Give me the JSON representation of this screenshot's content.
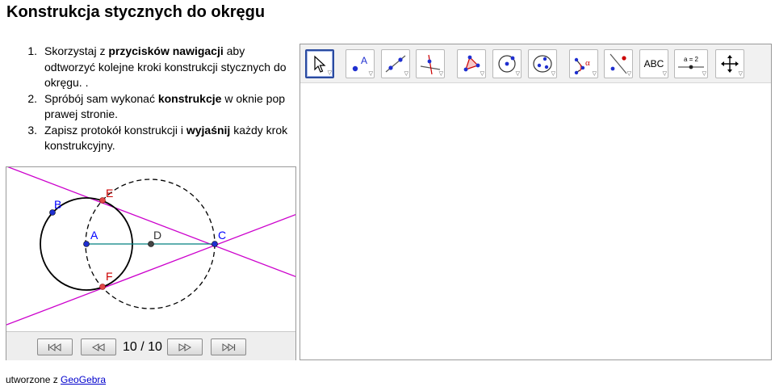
{
  "page": {
    "title": "Konstrukcja stycznych do okręgu",
    "instructions": [
      {
        "num": "1.",
        "before": "Skorzystaj z ",
        "bold": "przycisków nawigacji",
        "after": " aby odtworzyć kolejne kroki konstrukcji stycznych do okręgu. ."
      },
      {
        "num": "2.",
        "before": "Spróbój sam wykonać ",
        "bold": "konstrukcje",
        "after": " w oknie pop prawej stronie."
      },
      {
        "num": "3.",
        "before": "Zapisz protokół konstrukcji i ",
        "bold": "wyjaśnij",
        "after": " każdy krok konstrukcyjny."
      }
    ],
    "footer": {
      "prefix": "utworzone z ",
      "link": "GeoGebra"
    }
  },
  "construction_view": {
    "points": [
      {
        "label": "A",
        "color": "#0000ff"
      },
      {
        "label": "B",
        "color": "#0000ff"
      },
      {
        "label": "C",
        "color": "#0000ff"
      },
      {
        "label": "D",
        "color": "#333333"
      },
      {
        "label": "E",
        "color": "#cc0000"
      },
      {
        "label": "F",
        "color": "#cc0000"
      }
    ],
    "tangent_color": "#cc00cc",
    "segment_color": "#008080",
    "step_counter": "10 / 10"
  },
  "navigation": {
    "buttons": [
      {
        "name": "first-step-icon",
        "glyph": "|◁◁"
      },
      {
        "name": "previous-step-icon",
        "glyph": "◁◁"
      },
      {
        "name": "next-step-icon",
        "glyph": "▷▷"
      },
      {
        "name": "last-step-icon",
        "glyph": "▷▷|"
      }
    ]
  },
  "toolbar": {
    "tools": [
      {
        "name": "move-tool-icon",
        "label": ""
      },
      {
        "name": "point-tool-icon",
        "label": "A"
      },
      {
        "name": "line-tool-icon",
        "label": ""
      },
      {
        "name": "perpendicular-tool-icon",
        "label": ""
      },
      {
        "name": "polygon-tool-icon",
        "label": ""
      },
      {
        "name": "circle-tool-icon",
        "label": ""
      },
      {
        "name": "conic-tool-icon",
        "label": ""
      },
      {
        "name": "angle-tool-icon",
        "label": "α"
      },
      {
        "name": "reflect-tool-icon",
        "label": ""
      },
      {
        "name": "text-tool-icon",
        "label": "ABC"
      },
      {
        "name": "slider-tool-icon",
        "label": "a = 2"
      },
      {
        "name": "move-view-tool-icon",
        "label": ""
      }
    ]
  }
}
